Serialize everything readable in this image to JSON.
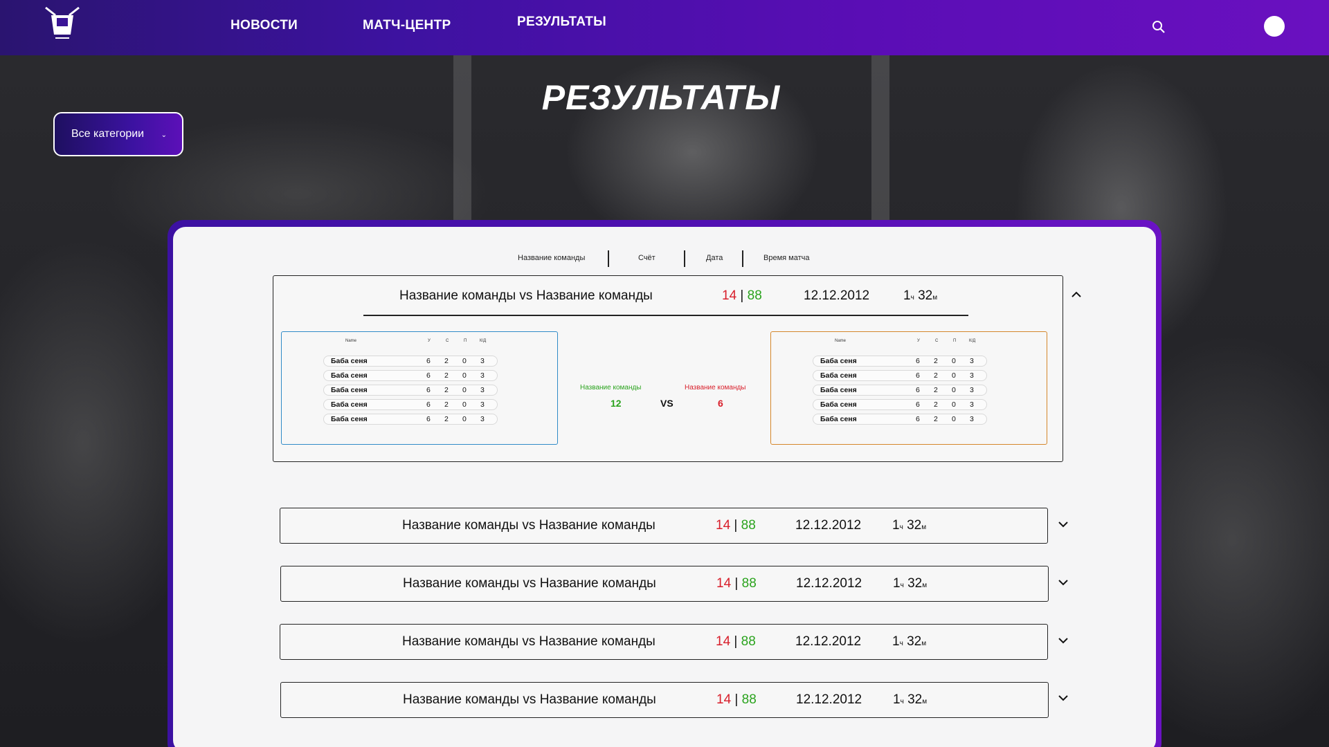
{
  "nav": {
    "items": [
      {
        "label": "НОВОСТИ"
      },
      {
        "label": "МАТЧ-ЦЕНТР"
      },
      {
        "label": "РЕЗУЛЬТАТЫ"
      }
    ]
  },
  "page": {
    "title": "РЕЗУЛЬТАТЫ"
  },
  "filter": {
    "category_label": "Все категории"
  },
  "table": {
    "headers": [
      "Название команды",
      "Счёт",
      "Дата",
      "Время матча"
    ]
  },
  "expanded_match": {
    "title": "Название команды vs Название команды",
    "score_left": "14",
    "score_sep": "|",
    "score_right": "88",
    "date": "12.12.2012",
    "duration_hours": "1",
    "duration_hours_unit": "ч",
    "duration_minutes": "32",
    "duration_minutes_unit": "м",
    "stat_headers": [
      "Name",
      "У",
      "С",
      "П",
      "К/Д"
    ],
    "team_left": {
      "name": "Название команды",
      "score": "12",
      "players": [
        {
          "name": "Баба сеня",
          "u": "6",
          "s": "2",
          "p": "0",
          "kd": "3"
        },
        {
          "name": "Баба сеня",
          "u": "6",
          "s": "2",
          "p": "0",
          "kd": "3"
        },
        {
          "name": "Баба сеня",
          "u": "6",
          "s": "2",
          "p": "0",
          "kd": "3"
        },
        {
          "name": "Баба сеня",
          "u": "6",
          "s": "2",
          "p": "0",
          "kd": "3"
        },
        {
          "name": "Баба сеня",
          "u": "6",
          "s": "2",
          "p": "0",
          "kd": "3"
        }
      ]
    },
    "vs_label": "VS",
    "team_right": {
      "name": "Название команды",
      "score": "6",
      "players": [
        {
          "name": "Баба сеня",
          "u": "6",
          "s": "2",
          "p": "0",
          "kd": "3"
        },
        {
          "name": "Баба сеня",
          "u": "6",
          "s": "2",
          "p": "0",
          "kd": "3"
        },
        {
          "name": "Баба сеня",
          "u": "6",
          "s": "2",
          "p": "0",
          "kd": "3"
        },
        {
          "name": "Баба сеня",
          "u": "6",
          "s": "2",
          "p": "0",
          "kd": "3"
        },
        {
          "name": "Баба сеня",
          "u": "6",
          "s": "2",
          "p": "0",
          "kd": "3"
        }
      ]
    }
  },
  "matches": [
    {
      "title": "Название команды vs Название команды",
      "score_left": "14",
      "score_sep": "|",
      "score_right": "88",
      "date": "12.12.2012",
      "duration_hours": "1",
      "duration_hours_unit": "ч",
      "duration_minutes": "32",
      "duration_minutes_unit": "м"
    },
    {
      "title": "Название команды vs Название команды",
      "score_left": "14",
      "score_sep": "|",
      "score_right": "88",
      "date": "12.12.2012",
      "duration_hours": "1",
      "duration_hours_unit": "ч",
      "duration_minutes": "32",
      "duration_minutes_unit": "м"
    },
    {
      "title": "Название команды vs Название команды",
      "score_left": "14",
      "score_sep": "|",
      "score_right": "88",
      "date": "12.12.2012",
      "duration_hours": "1",
      "duration_hours_unit": "ч",
      "duration_minutes": "32",
      "duration_minutes_unit": "м"
    },
    {
      "title": "Название команды vs Название команды",
      "score_left": "14",
      "score_sep": "|",
      "score_right": "88",
      "date": "12.12.2012",
      "duration_hours": "1",
      "duration_hours_unit": "ч",
      "duration_minutes": "32",
      "duration_minutes_unit": "м"
    }
  ],
  "colors": {
    "header_start": "#2a1470",
    "header_end": "#6a10c0",
    "score_loss": "#d81e2a",
    "score_win": "#2aa31d",
    "team_left_border": "#2f8ac7",
    "team_right_border": "#d4862a"
  },
  "icons": {
    "logo": "logo-icon",
    "search": "search-icon",
    "avatar": "avatar",
    "select_chevron": "chevron-down-icon",
    "expand": "chevron-down-icon",
    "collapse": "chevron-up-icon"
  }
}
